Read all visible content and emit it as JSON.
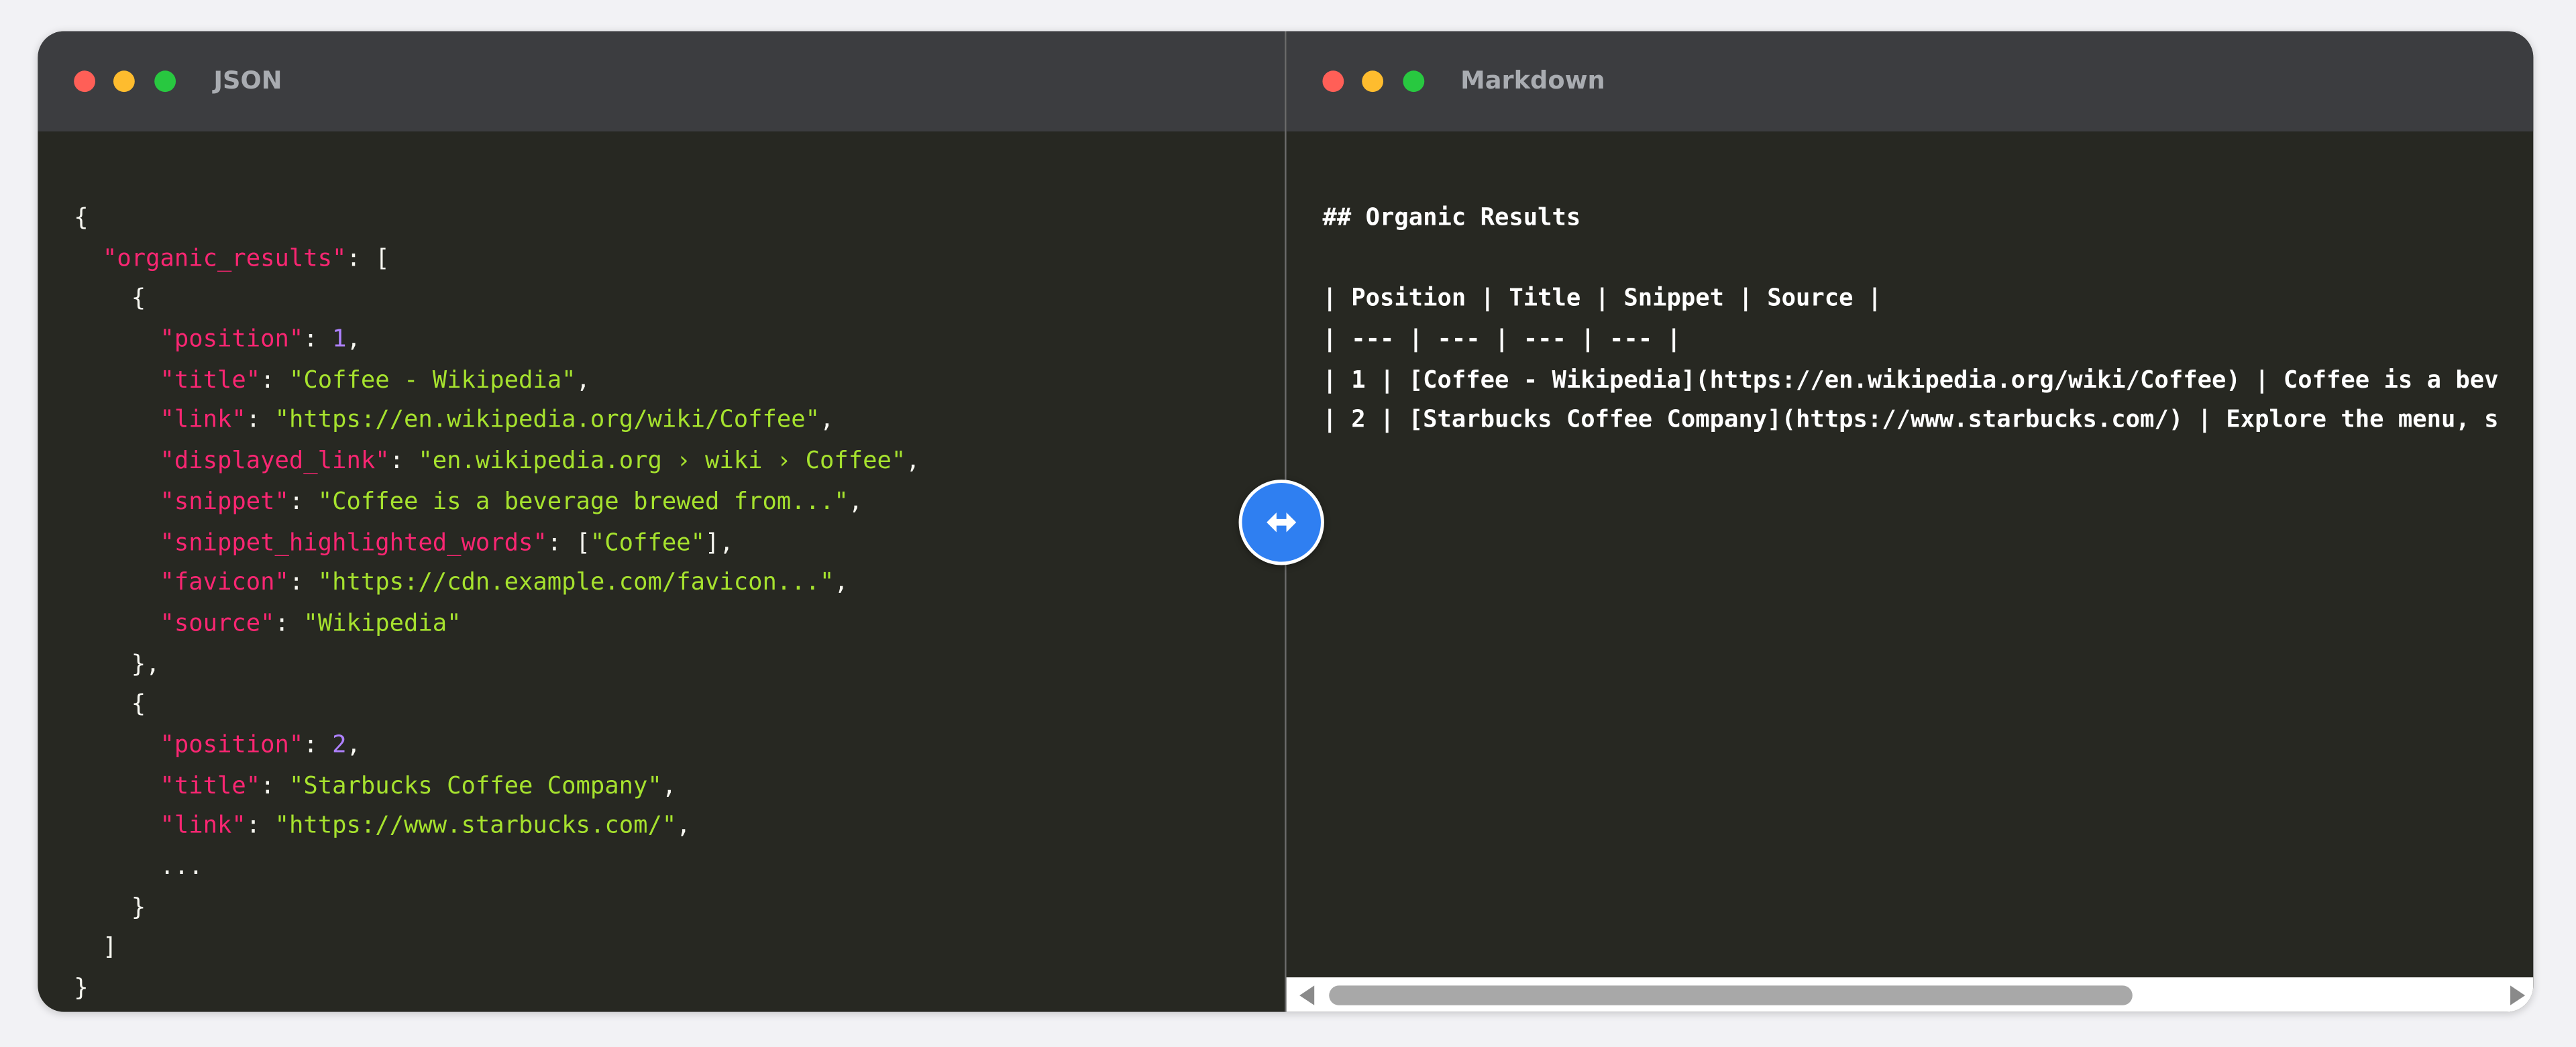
{
  "left_window": {
    "title": "JSON",
    "code_lines": [
      [
        {
          "t": "{",
          "c": "punc"
        }
      ],
      [
        {
          "t": "  ",
          "c": "punc"
        },
        {
          "t": "\"organic_results\"",
          "c": "key"
        },
        {
          "t": ": [",
          "c": "punc"
        }
      ],
      [
        {
          "t": "    {",
          "c": "punc"
        }
      ],
      [
        {
          "t": "      ",
          "c": "punc"
        },
        {
          "t": "\"position\"",
          "c": "key"
        },
        {
          "t": ": ",
          "c": "punc"
        },
        {
          "t": "1",
          "c": "num"
        },
        {
          "t": ",",
          "c": "punc"
        }
      ],
      [
        {
          "t": "      ",
          "c": "punc"
        },
        {
          "t": "\"title\"",
          "c": "key"
        },
        {
          "t": ": ",
          "c": "punc"
        },
        {
          "t": "\"Coffee - Wikipedia\"",
          "c": "str"
        },
        {
          "t": ",",
          "c": "punc"
        }
      ],
      [
        {
          "t": "      ",
          "c": "punc"
        },
        {
          "t": "\"link\"",
          "c": "key"
        },
        {
          "t": ": ",
          "c": "punc"
        },
        {
          "t": "\"https://en.wikipedia.org/wiki/Coffee\"",
          "c": "str"
        },
        {
          "t": ",",
          "c": "punc"
        }
      ],
      [
        {
          "t": "      ",
          "c": "punc"
        },
        {
          "t": "\"displayed_link\"",
          "c": "key"
        },
        {
          "t": ": ",
          "c": "punc"
        },
        {
          "t": "\"en.wikipedia.org › wiki › Coffee\"",
          "c": "str"
        },
        {
          "t": ",",
          "c": "punc"
        }
      ],
      [
        {
          "t": "      ",
          "c": "punc"
        },
        {
          "t": "\"snippet\"",
          "c": "key"
        },
        {
          "t": ": ",
          "c": "punc"
        },
        {
          "t": "\"Coffee is a beverage brewed from...\"",
          "c": "str"
        },
        {
          "t": ",",
          "c": "punc"
        }
      ],
      [
        {
          "t": "      ",
          "c": "punc"
        },
        {
          "t": "\"snippet_highlighted_words\"",
          "c": "key"
        },
        {
          "t": ": [",
          "c": "punc"
        },
        {
          "t": "\"Coffee\"",
          "c": "str"
        },
        {
          "t": "],",
          "c": "punc"
        }
      ],
      [
        {
          "t": "      ",
          "c": "punc"
        },
        {
          "t": "\"favicon\"",
          "c": "key"
        },
        {
          "t": ": ",
          "c": "punc"
        },
        {
          "t": "\"https://cdn.example.com/favicon...\"",
          "c": "str"
        },
        {
          "t": ",",
          "c": "punc"
        }
      ],
      [
        {
          "t": "      ",
          "c": "punc"
        },
        {
          "t": "\"source\"",
          "c": "key"
        },
        {
          "t": ": ",
          "c": "punc"
        },
        {
          "t": "\"Wikipedia\"",
          "c": "str"
        }
      ],
      [
        {
          "t": "    },",
          "c": "punc"
        }
      ],
      [
        {
          "t": "    {",
          "c": "punc"
        }
      ],
      [
        {
          "t": "      ",
          "c": "punc"
        },
        {
          "t": "\"position\"",
          "c": "key"
        },
        {
          "t": ": ",
          "c": "punc"
        },
        {
          "t": "2",
          "c": "num"
        },
        {
          "t": ",",
          "c": "punc"
        }
      ],
      [
        {
          "t": "      ",
          "c": "punc"
        },
        {
          "t": "\"title\"",
          "c": "key"
        },
        {
          "t": ": ",
          "c": "punc"
        },
        {
          "t": "\"Starbucks Coffee Company\"",
          "c": "str"
        },
        {
          "t": ",",
          "c": "punc"
        }
      ],
      [
        {
          "t": "      ",
          "c": "punc"
        },
        {
          "t": "\"link\"",
          "c": "key"
        },
        {
          "t": ": ",
          "c": "punc"
        },
        {
          "t": "\"https://www.starbucks.com/\"",
          "c": "str"
        },
        {
          "t": ",",
          "c": "punc"
        }
      ],
      [
        {
          "t": "      ...",
          "c": "punc"
        }
      ],
      [
        {
          "t": "    }",
          "c": "punc"
        }
      ],
      [
        {
          "t": "  ]",
          "c": "punc"
        }
      ],
      [
        {
          "t": "}",
          "c": "punc"
        }
      ]
    ]
  },
  "right_window": {
    "title": "Markdown",
    "markdown_lines": [
      "## Organic Results",
      "",
      "| Position | Title | Snippet | Source |",
      "| --- | --- | --- | --- |",
      "| 1 | [Coffee - Wikipedia](https://en.wikipedia.org/wiki/Coffee) | Coffee is a bev",
      "| 2 | [Starbucks Coffee Company](https://www.starbucks.com/) | Explore the menu, s"
    ],
    "scrollbar": {
      "position": 0.0,
      "visible_fraction": 0.69
    }
  },
  "divider": {
    "icon": "left-right-arrow-icon"
  },
  "colors": {
    "key": "#f92672",
    "string": "#a6e22e",
    "number": "#ae81ff",
    "accent": "#2f7ff1",
    "editor_bg": "#272822",
    "titlebar_bg": "#3c3d40"
  }
}
